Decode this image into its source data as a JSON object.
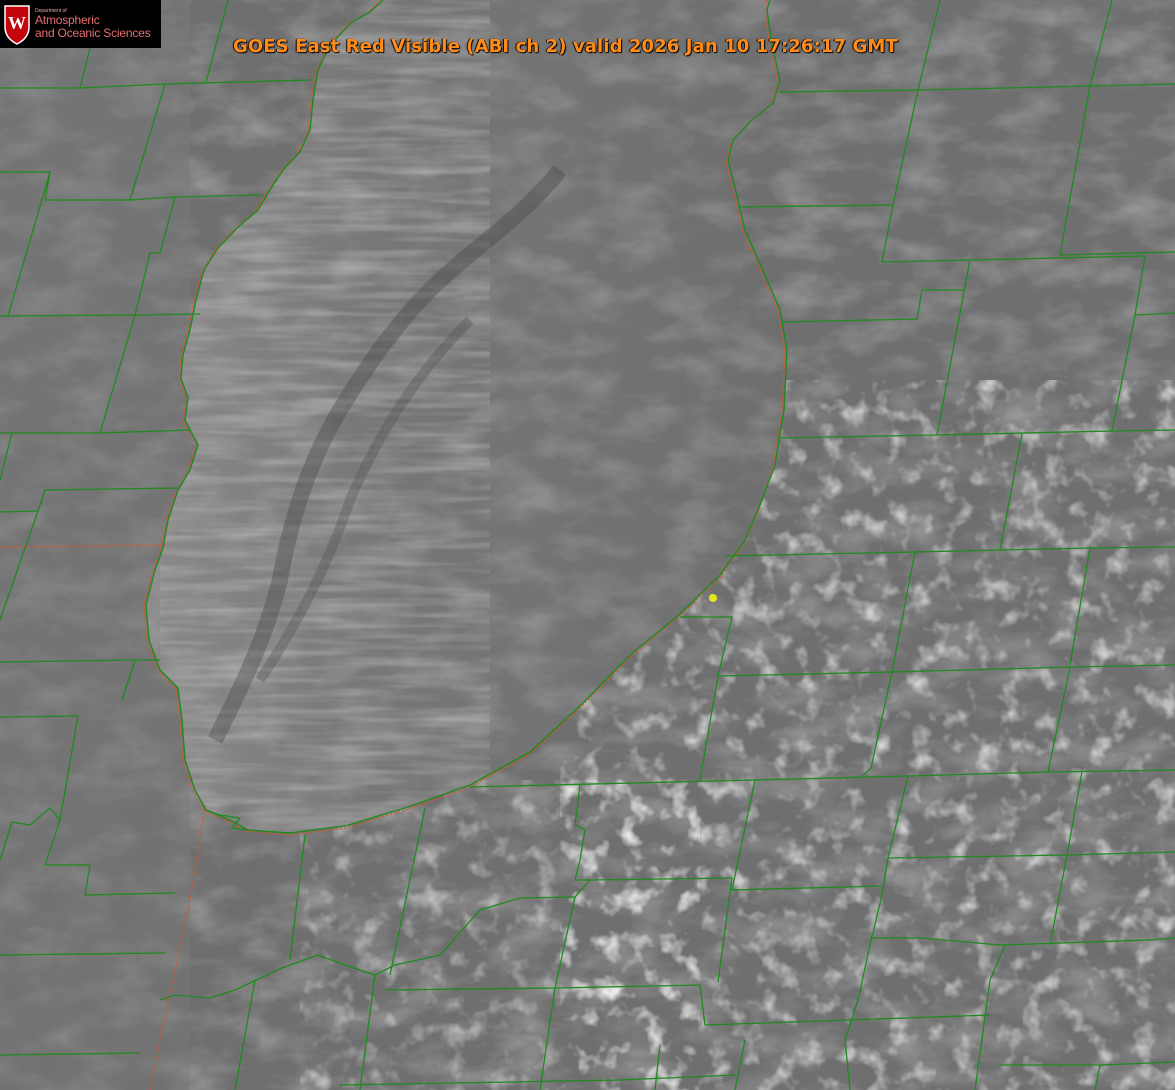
{
  "title": "GOES East Red Visible (ABI ch 2) valid 2026 Jan 10 17:26:17 GMT",
  "logo": {
    "department_line": "Department of",
    "line1": "Atmospheric",
    "line2": "and Oceanic Sciences",
    "seal_letter": "W",
    "seal_color": "#c5050c"
  },
  "colors": {
    "county_borders": "#1f8a1f",
    "state_border": "#d9532a",
    "title_text": "#ff8c1a",
    "marker": "#e6e61a"
  },
  "marker": {
    "icon": "location-dot"
  }
}
